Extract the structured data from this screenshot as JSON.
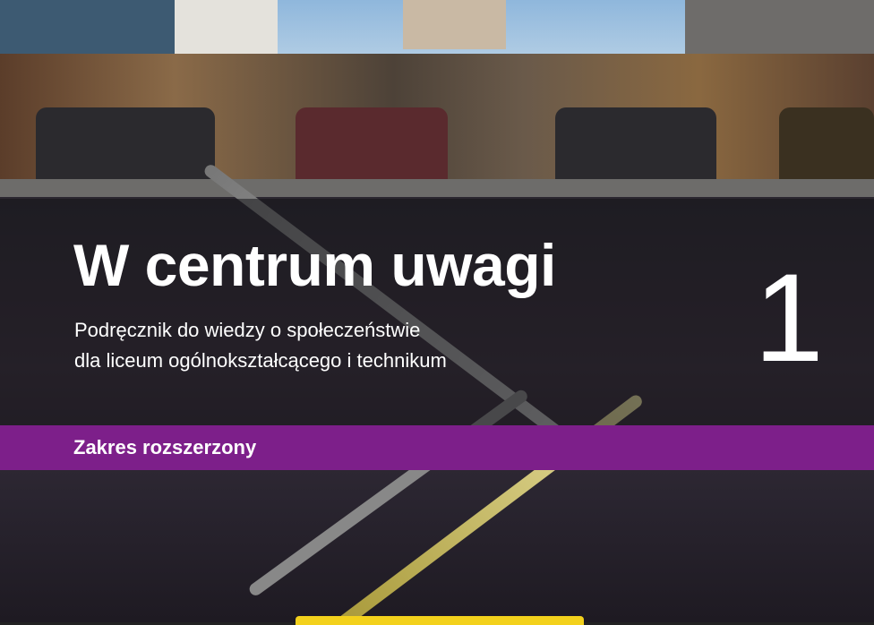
{
  "cover": {
    "title": "W centrum uwagi",
    "subtitle_line1": "Podręcznik do wiedzy o społeczeństwie",
    "subtitle_line2": "dla liceum ogólnokształcącego i technikum",
    "volume_number": "1",
    "scope_band": "Zakres rozszerzony"
  },
  "colors": {
    "band": "#7d1f8a",
    "accent_yellow": "#f3d11c"
  }
}
